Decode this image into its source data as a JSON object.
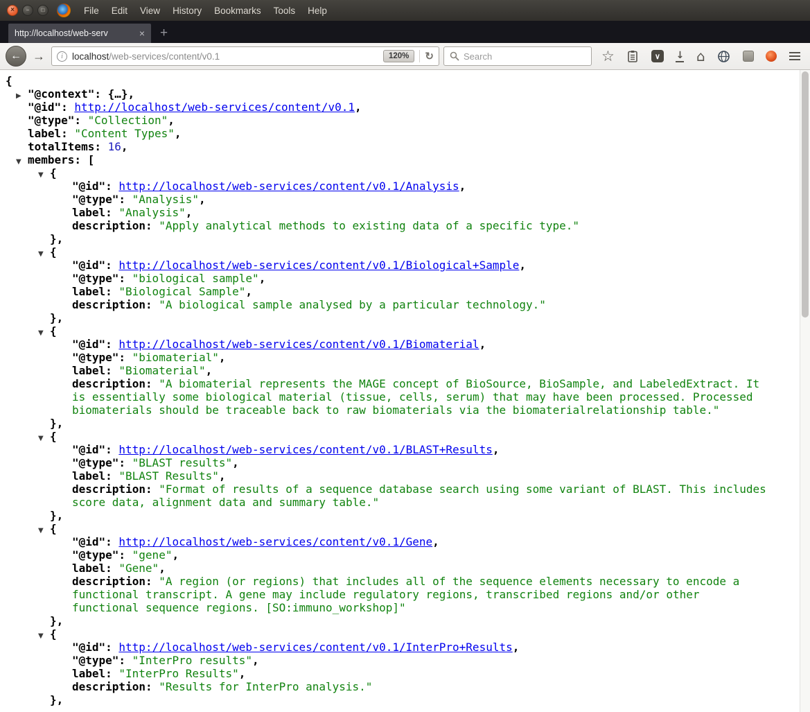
{
  "titlebar": {
    "menu": [
      "File",
      "Edit",
      "View",
      "History",
      "Bookmarks",
      "Tools",
      "Help"
    ]
  },
  "tabs": {
    "active_title": "http://localhost/web-serv",
    "close_label": "×",
    "new_tab_label": "+"
  },
  "navbar": {
    "url_host": "localhost",
    "url_path": "/web-services/content/v0.1",
    "zoom_badge": "120%",
    "search_placeholder": "Search"
  },
  "icons": {
    "window_close": "×",
    "window_minimize": "−",
    "window_maximize": "□",
    "back": "←",
    "forward": "→",
    "info": "i",
    "reload": "↻",
    "star": "☆",
    "pocket_chevron": "∨",
    "download_arrow": "↓",
    "home": "⌂",
    "search": "magnifier-shape",
    "bookmarks_list": "clipboard-shape",
    "globe": "globe-shape",
    "menu": "hamburger-shape"
  },
  "viewer": {
    "punct": {
      "open_brace": "{",
      "close_brace_comma": "},",
      "open_bracket": "[",
      "comma": ",",
      "collapsed_object": "{…},",
      "caret_collapsed": "▶",
      "caret_expanded": "▼"
    },
    "keys": {
      "context": "\"@context\":",
      "id": "\"@id\":",
      "type": "\"@type\":",
      "label": "label:",
      "total": "totalItems:",
      "members": "members:",
      "description": "description:"
    },
    "root": {
      "id_href": "http://localhost/web-services/content/v0.1",
      "type_value": "\"Collection\"",
      "label_value": "\"Content Types\"",
      "total_value": "16"
    },
    "members": [
      {
        "id_href": "http://localhost/web-services/content/v0.1/Analysis",
        "type_value": "\"Analysis\"",
        "label_value": "\"Analysis\"",
        "description_value": "\"Apply analytical methods to existing data of a specific type.\""
      },
      {
        "id_href": "http://localhost/web-services/content/v0.1/Biological+Sample",
        "type_value": "\"biological sample\"",
        "label_value": "\"Biological Sample\"",
        "description_value": "\"A biological sample analysed by a particular technology.\""
      },
      {
        "id_href": "http://localhost/web-services/content/v0.1/Biomaterial",
        "type_value": "\"biomaterial\"",
        "label_value": "\"Biomaterial\"",
        "description_value": "\"A biomaterial represents the MAGE concept of BioSource, BioSample, and LabeledExtract. It is essentially some biological material (tissue, cells, serum) that may have been processed. Processed biomaterials should be traceable back to raw biomaterials via the biomaterialrelationship table.\""
      },
      {
        "id_href": "http://localhost/web-services/content/v0.1/BLAST+Results",
        "type_value": "\"BLAST results\"",
        "label_value": "\"BLAST Results\"",
        "description_value": "\"Format of results of a sequence database search using some variant of BLAST. This includes score data, alignment data and summary table.\""
      },
      {
        "id_href": "http://localhost/web-services/content/v0.1/Gene",
        "type_value": "\"gene\"",
        "label_value": "\"Gene\"",
        "description_value": "\"A region (or regions) that includes all of the sequence elements necessary to encode a functional transcript. A gene may include regulatory regions, transcribed regions and/or other functional sequence regions. [SO:immuno_workshop]\""
      },
      {
        "id_href": "http://localhost/web-services/content/v0.1/InterPro+Results",
        "type_value": "\"InterPro results\"",
        "label_value": "\"InterPro Results\"",
        "description_value": "\"Results for InterPro analysis.\""
      }
    ]
  }
}
